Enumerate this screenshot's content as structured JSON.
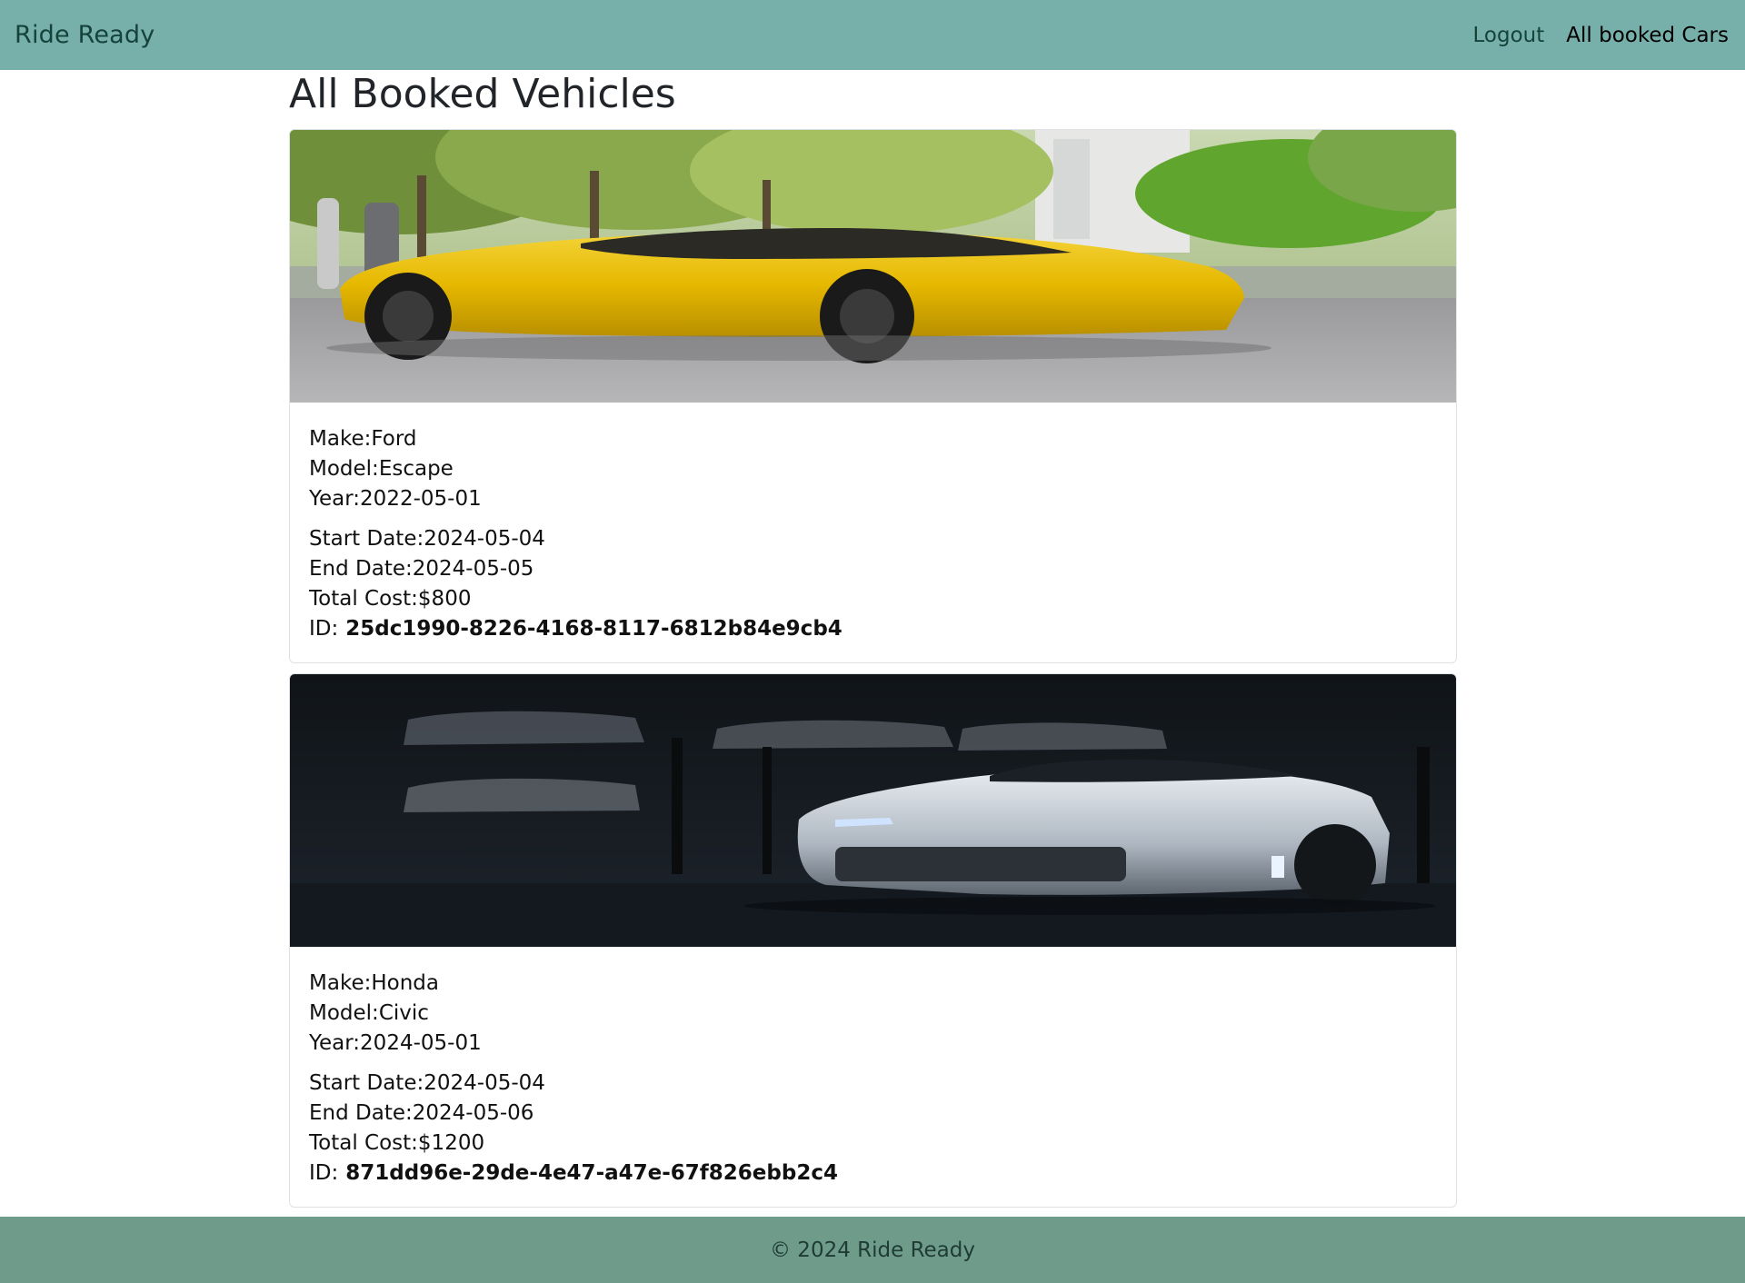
{
  "navbar": {
    "brand": "Ride Ready",
    "links": [
      {
        "label": "Logout"
      },
      {
        "label": "All booked Cars"
      }
    ]
  },
  "page": {
    "title": "All Booked Vehicles"
  },
  "bookings": [
    {
      "image": "yellow-sports-car-photo",
      "make_label": "Make:",
      "make": "Ford",
      "model_label": "Model:",
      "model": "Escape",
      "year_label": "Year:",
      "year": "2022-05-01",
      "start_label": "Start Date:",
      "start_date": "2024-05-04",
      "end_label": "End Date:",
      "end_date": "2024-05-05",
      "cost_label": "Total Cost:",
      "total_cost": "$800",
      "id_label": "ID:",
      "id": "25dc1990-8226-4168-8117-6812b84e9cb4"
    },
    {
      "image": "white-muscle-car-garage-photo",
      "make_label": "Make:",
      "make": "Honda",
      "model_label": "Model:",
      "model": "Civic",
      "year_label": "Year:",
      "year": "2024-05-01",
      "start_label": "Start Date:",
      "start_date": "2024-05-04",
      "end_label": "End Date:",
      "end_date": "2024-05-06",
      "cost_label": "Total Cost:",
      "total_cost": "$1200",
      "id_label": "ID:",
      "id": "871dd96e-29de-4e47-a47e-67f826ebb2c4"
    }
  ],
  "footer": {
    "text": "© 2024 Ride Ready"
  },
  "colors": {
    "navbar_bg": "#77b0aa",
    "brand_text": "#16423c",
    "footer_bg": "#6f9c8a"
  }
}
